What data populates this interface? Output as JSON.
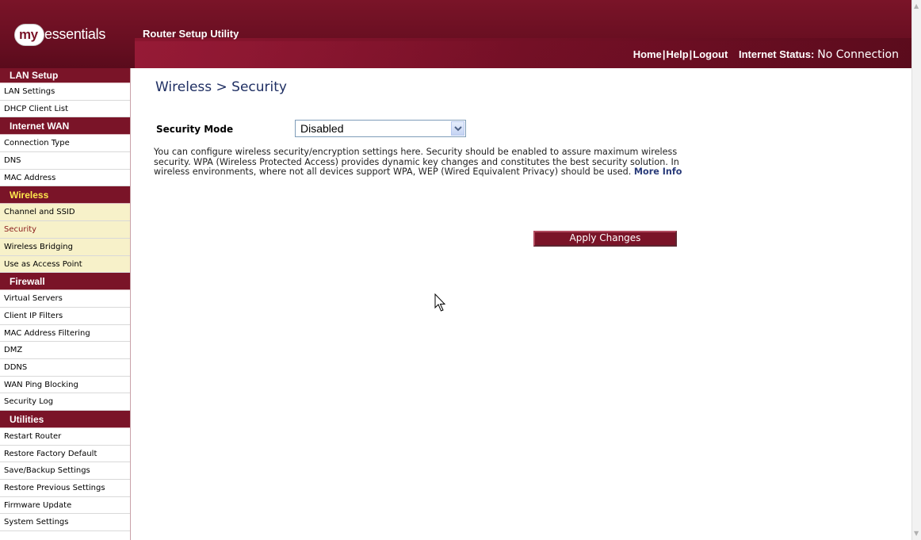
{
  "header": {
    "logo": {
      "prefix": "my",
      "suffix": "essentials"
    },
    "app_title": "Router Setup Utility",
    "nav": {
      "home": "Home",
      "help": "Help",
      "logout": "Logout",
      "sep": "|"
    },
    "status_label": "Internet Status:",
    "status_value": "No Connection",
    "brand_color": "#7a1428"
  },
  "sidebar": {
    "sections": [
      {
        "title": "LAN Setup",
        "items": [
          "LAN Settings",
          "DHCP Client List"
        ]
      },
      {
        "title": "Internet WAN",
        "items": [
          "Connection Type",
          "DNS",
          "MAC Address"
        ]
      },
      {
        "title": "Wireless",
        "items": [
          "Channel and SSID",
          "Security",
          "Wireless Bridging",
          "Use as Access Point"
        ]
      },
      {
        "title": "Firewall",
        "items": [
          "Virtual Servers",
          "Client IP Filters",
          "MAC Address Filtering",
          "DMZ",
          "DDNS",
          "WAN Ping Blocking",
          "Security Log"
        ]
      },
      {
        "title": "Utilities",
        "items": [
          "Restart Router",
          "Restore Factory Default",
          "Save/Backup Settings",
          "Restore Previous Settings",
          "Firmware Update",
          "System Settings"
        ]
      }
    ],
    "active_section": "Wireless",
    "active_item": "Security"
  },
  "main": {
    "title": "Wireless > Security",
    "security_mode_label": "Security Mode",
    "security_mode_value": "Disabled",
    "description": "You can configure wireless security/encryption settings here. Security should be enabled to assure maximum wireless security. WPA (Wireless Protected Access) provides dynamic key changes and constitutes the best security solution. In wireless environments, where not all devices support WPA, WEP (Wired Equivalent Privacy) should be used.",
    "more_info": "More Info",
    "apply_button": "Apply Changes"
  }
}
